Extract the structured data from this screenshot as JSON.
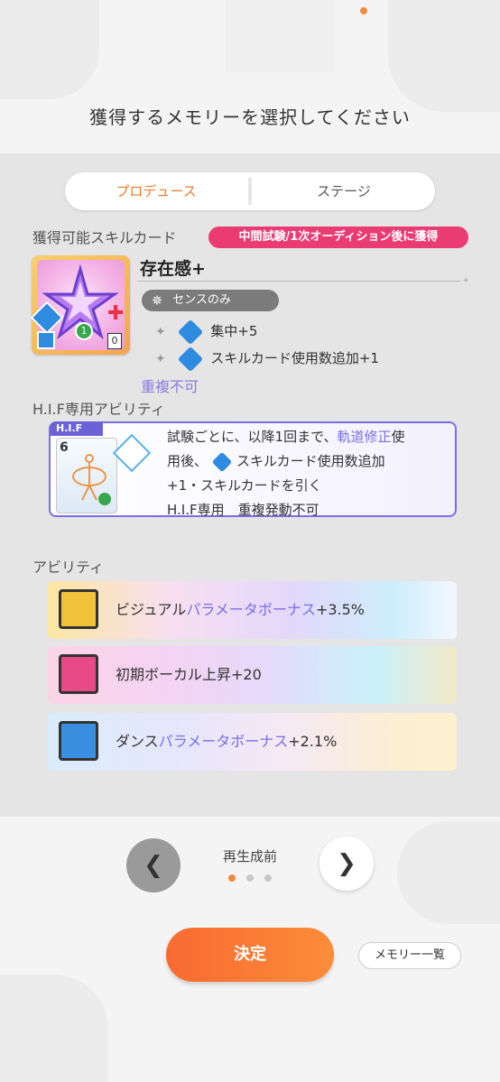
{
  "header": {
    "title": "獲得するメモリーを選択してください"
  },
  "tabs": {
    "produce": "プロデュース",
    "stage": "ステージ"
  },
  "skill_section": {
    "label": "獲得可能スキルカード",
    "badge": "中間試験/1次オーディション後に獲得",
    "card": {
      "name": "存在感+",
      "sense_label": "センスのみ",
      "cost": "1",
      "counter": "0"
    },
    "effects": [
      {
        "text": "集中+5"
      },
      {
        "text": "スキルカード使用数追加+1"
      }
    ],
    "no_duplicate": "重複不可"
  },
  "hif_section": {
    "label": "H.I.F専用アビリティ",
    "tag": "H.I.F",
    "card_number": "6",
    "text_line1_a": "試験ごとに、以降1回まで、",
    "text_line1_b": "軌道修正",
    "text_line1_c": "使",
    "text_line2_a": "用後、",
    "text_line2_b": "スキルカード使用数追加",
    "text_line3": "+1・スキルカードを引く",
    "text_line4": "H.I.F専用　重複発動不可"
  },
  "abilities": {
    "label": "アビリティ",
    "items": [
      {
        "prefix": "ビジュアル",
        "highlight": "パラメータボーナス",
        "suffix": "+3.5%",
        "icon": "visual-icon",
        "color": "#f2c23a"
      },
      {
        "prefix": "初期ボーカル上昇+20",
        "highlight": "",
        "suffix": "",
        "icon": "vocal-microphone-icon",
        "color": "#e84a86"
      },
      {
        "prefix": "ダンス",
        "highlight": "パラメータボーナス",
        "suffix": "+2.1%",
        "icon": "dance-icon",
        "color": "#3a8fe0"
      }
    ]
  },
  "pager": {
    "label": "再生成前",
    "pages": 3,
    "current": 1
  },
  "footer": {
    "confirm": "決定",
    "memory_list": "メモリー一覧"
  },
  "colors": {
    "accent": "#f07a2a",
    "pink": "#ea3b73",
    "purple": "#7a6ee6"
  }
}
